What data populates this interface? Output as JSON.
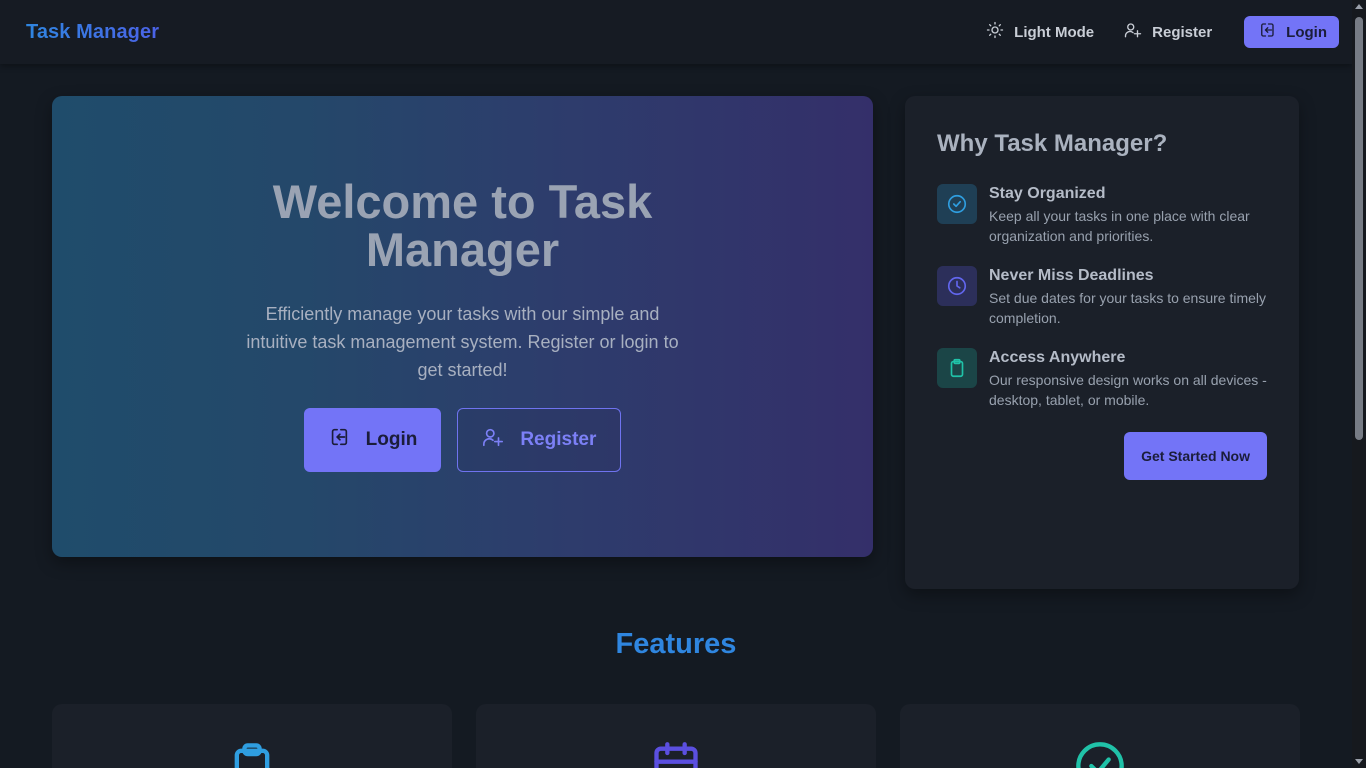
{
  "header": {
    "brand": "Task Manager",
    "theme_toggle_label": "Light Mode",
    "register_label": "Register",
    "login_label": "Login"
  },
  "hero": {
    "title": "Welcome to Task Manager",
    "subtitle": "Efficiently manage your tasks with our simple and intuitive task management system. Register or login to get started!",
    "login_label": "Login",
    "register_label": "Register"
  },
  "why": {
    "title": "Why Task Manager?",
    "items": [
      {
        "title": "Stay Organized",
        "description": "Keep all your tasks in one place with clear organization and priorities.",
        "icon": "check-circle-icon"
      },
      {
        "title": "Never Miss Deadlines",
        "description": "Set due dates for your tasks to ensure timely completion.",
        "icon": "clock-icon"
      },
      {
        "title": "Access Anywhere",
        "description": "Our responsive design works on all devices - desktop, tablet, or mobile.",
        "icon": "clipboard-icon"
      }
    ],
    "cta_label": "Get Started Now"
  },
  "features": {
    "title": "Features",
    "cards": [
      {
        "icon": "clipboard-icon",
        "color": "#2f9ee0"
      },
      {
        "icon": "calendar-icon",
        "color": "#5b4fe0"
      },
      {
        "icon": "check-circle-icon",
        "color": "#20c2a8"
      }
    ]
  },
  "colors": {
    "accent": "#7374f7",
    "brand_blue": "#2f86e0",
    "background": "#141a22"
  }
}
